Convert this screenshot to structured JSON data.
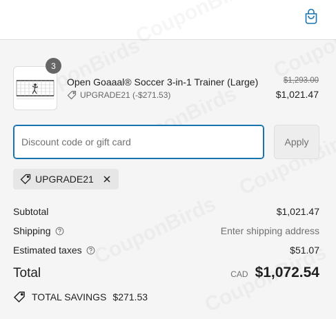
{
  "header": {
    "cart_icon": "shopping-bag-icon"
  },
  "product": {
    "quantity": "3",
    "name": "Open Goaaal® Soccer 3-in-1 Trainer (Large)",
    "discount_line": "UPGRADE21 (-$271.53)",
    "original_price": "$1,293.00",
    "price": "$1,021.47"
  },
  "discount": {
    "placeholder": "Discount code or gift card",
    "apply_label": "Apply",
    "applied_code": "UPGRADE21"
  },
  "summary": {
    "subtotal_label": "Subtotal",
    "subtotal_value": "$1,021.47",
    "shipping_label": "Shipping",
    "shipping_value": "Enter shipping address",
    "taxes_label": "Estimated taxes",
    "taxes_value": "$51.07",
    "total_label": "Total",
    "currency": "CAD",
    "total_value": "$1,072.54",
    "savings_label": "TOTAL SAVINGS",
    "savings_value": "$271.53"
  },
  "watermark": "CouponBirds",
  "colors": {
    "accent": "#1773b0",
    "background": "#f5f5f5",
    "badge": "#666666"
  }
}
